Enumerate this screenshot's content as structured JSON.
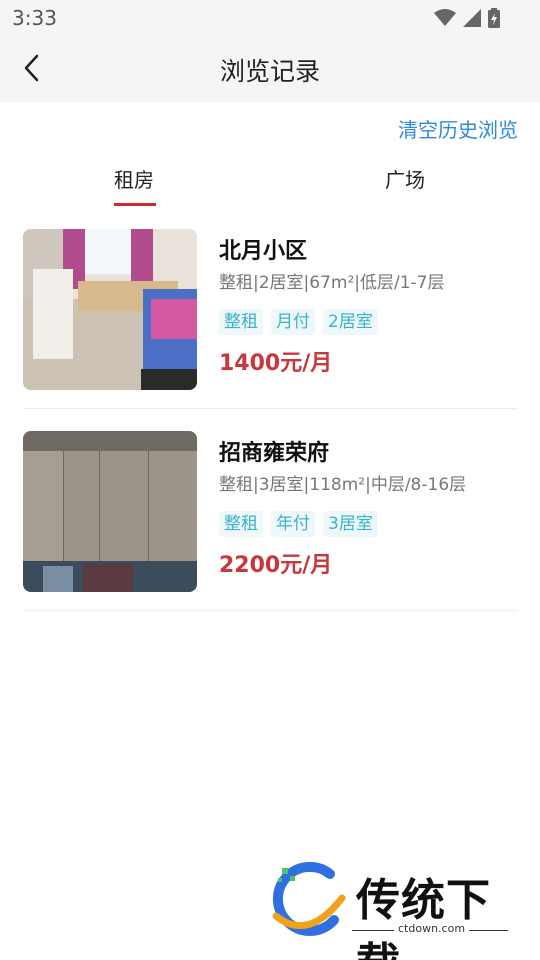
{
  "status_bar": {
    "time": "3:33"
  },
  "header": {
    "title": "浏览记录"
  },
  "actions": {
    "clear_history": "清空历史浏览"
  },
  "tabs": [
    {
      "label": "租房",
      "active": true
    },
    {
      "label": "广场",
      "active": false
    }
  ],
  "listings": [
    {
      "name": "北月小区",
      "desc": "整租|2居室|67m²|低层/1-7层",
      "tags": [
        "整租",
        "月付",
        "2居室"
      ],
      "price": "1400元/月"
    },
    {
      "name": "招商雍荣府",
      "desc": "整租|3居室|118m²|中层/8-16层",
      "tags": [
        "整租",
        "年付",
        "3居室"
      ],
      "price": "2200元/月"
    }
  ],
  "watermark": {
    "brand": "传统下载",
    "url": "ctdown.com"
  },
  "colors": {
    "accent_red": "#c9363b",
    "tab_underline": "#d12c2c",
    "link_blue": "#2b8ae0",
    "tag_text": "#3ab3c9",
    "tag_bg": "#eef8fb"
  }
}
